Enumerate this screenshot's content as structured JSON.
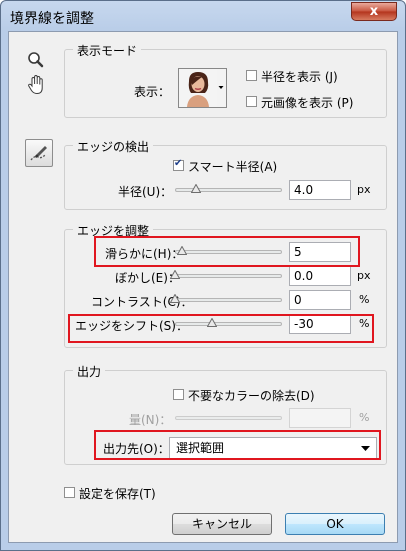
{
  "window": {
    "title": "境界線を調整",
    "close_glyph": "x"
  },
  "view_mode": {
    "section_title": "表示モード",
    "display_label": "表示：",
    "show_radius": {
      "label": "半径を表示 (J)",
      "checked": false
    },
    "show_original": {
      "label": "元画像を表示 (P)",
      "checked": false
    }
  },
  "edge_detection": {
    "section_title": "エッジの検出",
    "smart_radius": {
      "label": "スマート半径(A)",
      "checked": true
    },
    "radius": {
      "label": "半径(U)：",
      "value": "4.0",
      "unit": "px",
      "level": 0.15
    }
  },
  "adjust_edge": {
    "section_title": "エッジを調整",
    "smooth": {
      "label": "滑らかに(H)：",
      "value": "5",
      "unit": "",
      "level": 0.05
    },
    "feather": {
      "label": "ぼかし(E)：",
      "value": "0.0",
      "unit": "px",
      "level": 0.0
    },
    "contrast": {
      "label": "コントラスト(C)：",
      "value": "0",
      "unit": "%",
      "level": 0.0
    },
    "shift_edge": {
      "label": "エッジをシフト(S)：",
      "value": "-30",
      "unit": "%",
      "level": 0.35
    }
  },
  "output": {
    "section_title": "出力",
    "decontaminate": {
      "label": "不要なカラーの除去(D)",
      "checked": false
    },
    "amount": {
      "label": "量(N)：",
      "value": "",
      "unit": "%",
      "disabled": true
    },
    "output_to": {
      "label": "出力先(O)：",
      "value": "選択範囲"
    }
  },
  "remember": {
    "label": "設定を保存(T)",
    "checked": false
  },
  "buttons": {
    "cancel": "キャンセル",
    "ok": "OK"
  },
  "colors": {
    "highlight": "#e0161f",
    "title_bar": "#b9cde8",
    "close": "#c7533c"
  }
}
